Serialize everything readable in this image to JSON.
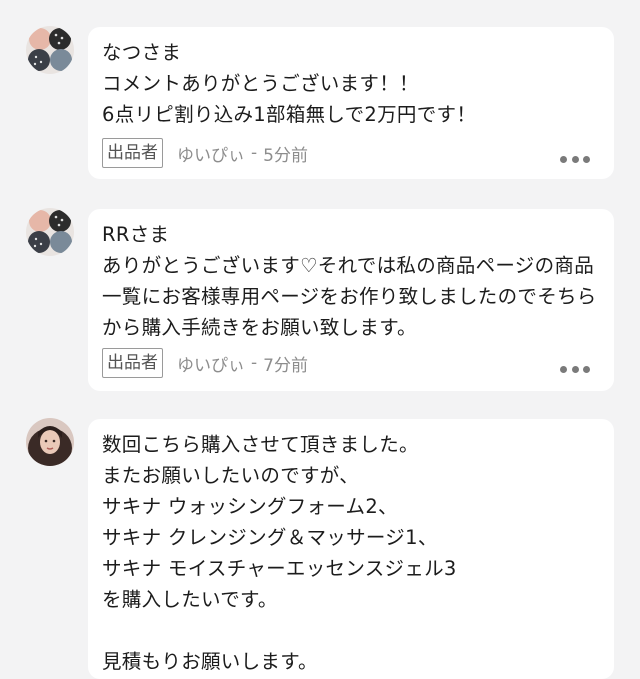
{
  "comments": [
    {
      "body": "なつさま\nコメントありがとうございます！！\n6点リピ割り込み1部箱無しで2万円です！",
      "badge": "出品者",
      "author": "ゆいぴぃ",
      "time": "5分前",
      "more_icon": "more-horizontal-icon"
    },
    {
      "body": "RRさま\nありがとうございます♡それでは私の商品ページの商品一覧にお客様専用ページをお作り致しましたのでそちらから購入手続きをお願い致します。",
      "badge": "出品者",
      "author": "ゆいぴぃ",
      "time": "7分前",
      "more_icon": "more-horizontal-icon"
    },
    {
      "body": "数回こちら購入させて頂きました。\nまたお願いしたいのですが、\nサキナ ウォッシングフォーム2、\nサキナ クレンジング＆マッサージ1、\nサキナ モイスチャーエッセンスジェル3\nを購入したいです。\n\n見積もりお願いします。"
    }
  ],
  "colors": {
    "background": "#f3f3f4",
    "bubble": "#ffffff",
    "meta_text": "#8d8d8d",
    "badge_border": "#9a9a9a"
  }
}
